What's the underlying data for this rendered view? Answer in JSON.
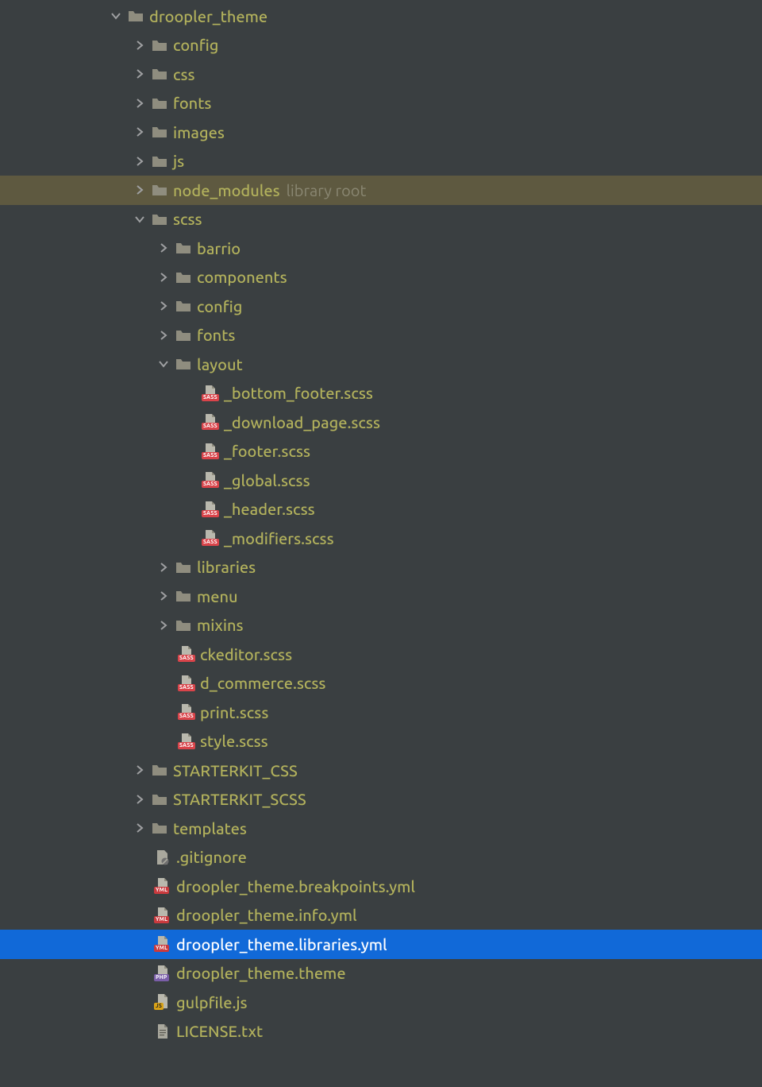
{
  "tree": [
    {
      "depth": 0,
      "kind": "folder",
      "arrow": "down",
      "name": "droopler_theme"
    },
    {
      "depth": 1,
      "kind": "folder",
      "arrow": "right",
      "name": "config"
    },
    {
      "depth": 1,
      "kind": "folder",
      "arrow": "right",
      "name": "css"
    },
    {
      "depth": 1,
      "kind": "folder",
      "arrow": "right",
      "name": "fonts"
    },
    {
      "depth": 1,
      "kind": "folder",
      "arrow": "right",
      "name": "images"
    },
    {
      "depth": 1,
      "kind": "folder",
      "arrow": "right",
      "name": "js"
    },
    {
      "depth": 1,
      "kind": "folder",
      "arrow": "right",
      "name": "node_modules",
      "suffix": "library root",
      "highlighted": true
    },
    {
      "depth": 1,
      "kind": "folder",
      "arrow": "down",
      "name": "scss"
    },
    {
      "depth": 2,
      "kind": "folder",
      "arrow": "right",
      "name": "barrio"
    },
    {
      "depth": 2,
      "kind": "folder",
      "arrow": "right",
      "name": "components"
    },
    {
      "depth": 2,
      "kind": "folder",
      "arrow": "right",
      "name": "config"
    },
    {
      "depth": 2,
      "kind": "folder",
      "arrow": "right",
      "name": "fonts"
    },
    {
      "depth": 2,
      "kind": "folder",
      "arrow": "down",
      "name": "layout"
    },
    {
      "depth": 3,
      "kind": "file",
      "icon": "sass",
      "name": "_bottom_footer.scss"
    },
    {
      "depth": 3,
      "kind": "file",
      "icon": "sass",
      "name": "_download_page.scss"
    },
    {
      "depth": 3,
      "kind": "file",
      "icon": "sass",
      "name": "_footer.scss"
    },
    {
      "depth": 3,
      "kind": "file",
      "icon": "sass",
      "name": "_global.scss"
    },
    {
      "depth": 3,
      "kind": "file",
      "icon": "sass",
      "name": "_header.scss"
    },
    {
      "depth": 3,
      "kind": "file",
      "icon": "sass",
      "name": "_modifiers.scss"
    },
    {
      "depth": 2,
      "kind": "folder",
      "arrow": "right",
      "name": "libraries"
    },
    {
      "depth": 2,
      "kind": "folder",
      "arrow": "right",
      "name": "menu"
    },
    {
      "depth": 2,
      "kind": "folder",
      "arrow": "right",
      "name": "mixins"
    },
    {
      "depth": 2,
      "kind": "file",
      "icon": "sass",
      "name": "ckeditor.scss",
      "indentAsFolderChild": true
    },
    {
      "depth": 2,
      "kind": "file",
      "icon": "sass",
      "name": "d_commerce.scss",
      "indentAsFolderChild": true
    },
    {
      "depth": 2,
      "kind": "file",
      "icon": "sass",
      "name": "print.scss",
      "indentAsFolderChild": true
    },
    {
      "depth": 2,
      "kind": "file",
      "icon": "sass",
      "name": "style.scss",
      "indentAsFolderChild": true
    },
    {
      "depth": 1,
      "kind": "folder",
      "arrow": "right",
      "name": "STARTERKIT_CSS"
    },
    {
      "depth": 1,
      "kind": "folder",
      "arrow": "right",
      "name": "STARTERKIT_SCSS"
    },
    {
      "depth": 1,
      "kind": "folder",
      "arrow": "right",
      "name": "templates"
    },
    {
      "depth": 1,
      "kind": "file",
      "icon": "gitignore",
      "name": ".gitignore",
      "indentAsFolderChild": true
    },
    {
      "depth": 1,
      "kind": "file",
      "icon": "yml",
      "name": "droopler_theme.breakpoints.yml",
      "indentAsFolderChild": true
    },
    {
      "depth": 1,
      "kind": "file",
      "icon": "yml",
      "name": "droopler_theme.info.yml",
      "indentAsFolderChild": true
    },
    {
      "depth": 1,
      "kind": "file",
      "icon": "yml",
      "name": "droopler_theme.libraries.yml",
      "indentAsFolderChild": true,
      "selected": true
    },
    {
      "depth": 1,
      "kind": "file",
      "icon": "php",
      "name": "droopler_theme.theme",
      "indentAsFolderChild": true
    },
    {
      "depth": 1,
      "kind": "file",
      "icon": "js",
      "name": "gulpfile.js",
      "indentAsFolderChild": true
    },
    {
      "depth": 1,
      "kind": "file",
      "icon": "text",
      "name": "LICENSE.txt",
      "indentAsFolderChild": true
    }
  ],
  "baseIndent": 136,
  "indentStep": 30,
  "arrowWidth": 24
}
